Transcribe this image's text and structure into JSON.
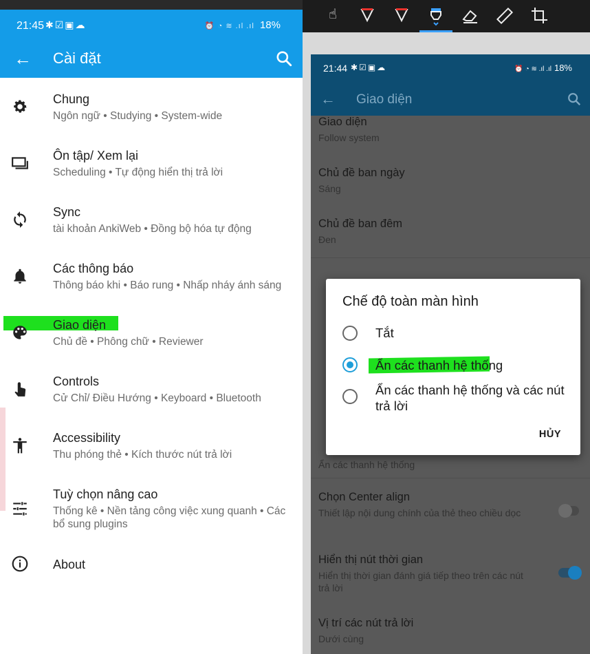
{
  "left_phone": {
    "status": {
      "time": "21:45",
      "battery": "18%"
    },
    "appbar": {
      "title": "Cài đặt"
    },
    "items": [
      {
        "title": "Chung",
        "subtitle": "Ngôn ngữ • Studying • System-wide",
        "icon": "gear-icon"
      },
      {
        "title": "Ôn tập/ Xem lại",
        "subtitle": "Scheduling • Tự động hiển thị trả lời",
        "icon": "cards-icon"
      },
      {
        "title": "Sync",
        "subtitle": "tài khoản AnkiWeb • Đồng bộ hóa tự động",
        "icon": "sync-icon"
      },
      {
        "title": "Các thông báo",
        "subtitle": "Thông báo khi • Báo rung • Nhấp nháy ánh sáng",
        "icon": "bell-icon"
      },
      {
        "title": "Giao diện",
        "subtitle": "Chủ đề • Phông chữ • Reviewer",
        "icon": "palette-icon"
      },
      {
        "title": "Controls",
        "subtitle": "Cử Chỉ/ Điều Hướng • Keyboard • Bluetooth",
        "icon": "touch-icon"
      },
      {
        "title": "Accessibility",
        "subtitle": "Thu phóng thẻ • Kích thước nút trả lời",
        "icon": "accessibility-icon"
      },
      {
        "title": "Tuỳ chọn nâng cao",
        "subtitle": "Thống kê • Nền tảng công việc xung quanh • Các bổ sung plugins",
        "icon": "sliders-icon"
      },
      {
        "title": "About",
        "subtitle": "",
        "icon": "info-icon"
      }
    ],
    "colors": {
      "appbar": "#149ce8",
      "highlight": "#1ee01e"
    }
  },
  "editor_toolbar": {
    "tools": [
      "hand-touch-icon",
      "pen-red-icon",
      "pen-red-2-icon",
      "highlighter-icon",
      "eraser-icon",
      "ruler-icon",
      "crop-icon"
    ],
    "active": "highlighter-icon"
  },
  "right_phone": {
    "status": {
      "time": "21:44",
      "battery": "18%"
    },
    "appbar": {
      "title": "Giao diện"
    },
    "items": [
      {
        "title": "Giao diện",
        "subtitle": "Follow system"
      },
      {
        "title": "Chủ đề ban ngày",
        "subtitle": "Sáng"
      },
      {
        "title": "Chủ đề ban đêm",
        "subtitle": "Đen"
      },
      {
        "title": "Ẩn các thanh hệ thống",
        "subtitle": ""
      },
      {
        "title": "Chọn Center align",
        "subtitle": "Thiết lập nội dung chính của thẻ theo chiều dọc"
      },
      {
        "title": "Hiển thị nút thời gian",
        "subtitle": "Hiển thị thời gian đánh giá tiếp theo trên các nút trả lời"
      },
      {
        "title": "Vị trí các nút trả lời",
        "subtitle": "Dưới cùng"
      }
    ],
    "dialog": {
      "title": "Chế độ toàn màn hình",
      "options": [
        {
          "label": "Tắt",
          "selected": false
        },
        {
          "label": "Ẩn các thanh hệ thống",
          "selected": true
        },
        {
          "label": "Ẩn các thanh hệ thống và các nút trả lời",
          "selected": false
        }
      ],
      "cancel": "HỦY"
    },
    "colors": {
      "appbar": "#0d4d72",
      "radio_active": "#1e9ed9"
    }
  }
}
